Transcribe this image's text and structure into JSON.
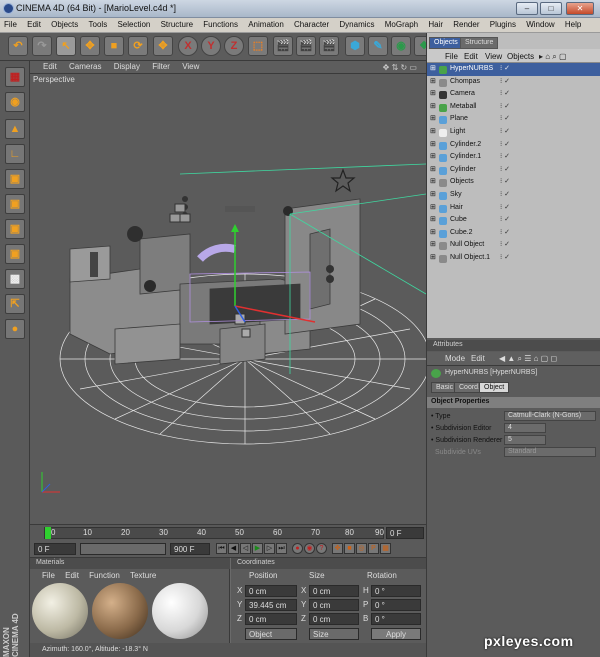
{
  "window": {
    "title": "CINEMA 4D (64 Bit) - [MarioLevel.c4d *]",
    "buttons": [
      "–",
      "□",
      "✕"
    ]
  },
  "menu": [
    "File",
    "Edit",
    "Objects",
    "Tools",
    "Selection",
    "Structure",
    "Functions",
    "Animation",
    "Character",
    "Dynamics",
    "MoGraph",
    "Hair",
    "Render",
    "Plugins",
    "Window",
    "Help"
  ],
  "toolbar": {
    "axis_labels": [
      "X",
      "Y",
      "Z"
    ]
  },
  "viewport": {
    "menu": [
      "Edit",
      "Cameras",
      "Display",
      "Filter",
      "View"
    ],
    "label": "Perspective"
  },
  "timeline": {
    "ticks": [
      "0",
      "10",
      "20",
      "30",
      "40",
      "50",
      "60",
      "70",
      "80",
      "90"
    ],
    "frame_field": "0 F"
  },
  "transport": {
    "start": "0 F",
    "end": "900 F"
  },
  "materials": {
    "header": "Materials",
    "menu": [
      "File",
      "Edit",
      "Function",
      "Texture"
    ]
  },
  "coordinates": {
    "header": "Coordinates",
    "cols": [
      "Position",
      "Size",
      "Rotation"
    ],
    "rows": [
      {
        "axis": "X",
        "pos": "0 cm",
        "size_axis": "X",
        "size": "0 cm",
        "rot_axis": "H",
        "rot": "0 °"
      },
      {
        "axis": "Y",
        "pos": "39.445 cm",
        "size_axis": "Y",
        "size": "0 cm",
        "rot_axis": "P",
        "rot": "0 °"
      },
      {
        "axis": "Z",
        "pos": "0 cm",
        "size_axis": "Z",
        "size": "0 cm",
        "rot_axis": "B",
        "rot": "0 °"
      }
    ],
    "mode1": "Object",
    "mode2": "Size",
    "apply": "Apply"
  },
  "status": "Azimuth: 160.0°, Altitude: -18.3°  N",
  "object_manager": {
    "tabs": [
      "Objects",
      "Structure"
    ],
    "menu": [
      "File",
      "Edit",
      "View",
      "Objects"
    ],
    "objects": [
      {
        "name": "HyperNURBS",
        "selected": true,
        "icon_color": "#49a34a"
      },
      {
        "name": "Chompas",
        "selected": false,
        "icon_color": "#8a8a8a"
      },
      {
        "name": "Camera",
        "selected": false,
        "icon_color": "#333333"
      },
      {
        "name": "Metaball",
        "selected": false,
        "icon_color": "#49a34a"
      },
      {
        "name": "Plane",
        "selected": false,
        "icon_color": "#5aa0d8"
      },
      {
        "name": "Light",
        "selected": false,
        "icon_color": "#eeeeee"
      },
      {
        "name": "Cylinder.2",
        "selected": false,
        "icon_color": "#5aa0d8"
      },
      {
        "name": "Cylinder.1",
        "selected": false,
        "icon_color": "#5aa0d8"
      },
      {
        "name": "Cylinder",
        "selected": false,
        "icon_color": "#5aa0d8"
      },
      {
        "name": "Objects",
        "selected": false,
        "icon_color": "#8a8a8a"
      },
      {
        "name": "Sky",
        "selected": false,
        "icon_color": "#5aa0d8"
      },
      {
        "name": "Hair",
        "selected": false,
        "icon_color": "#5aa0d8"
      },
      {
        "name": "Cube",
        "selected": false,
        "icon_color": "#5aa0d8"
      },
      {
        "name": "Cube.2",
        "selected": false,
        "icon_color": "#5aa0d8"
      },
      {
        "name": "Null Object",
        "selected": false,
        "icon_color": "#8a8a8a"
      },
      {
        "name": "Null Object.1",
        "selected": false,
        "icon_color": "#8a8a8a"
      }
    ]
  },
  "attributes": {
    "header": "Attributes",
    "menu": [
      "Mode",
      "Edit"
    ],
    "object_title": "HyperNURBS [HyperNURBS]",
    "tabs": [
      "Basic",
      "Coord.",
      "Object"
    ],
    "section": "Object Properties",
    "props": [
      {
        "label": "Type",
        "value": "Catmull-Clark (N-Gons)"
      },
      {
        "label": "Subdivision Editor",
        "value": "4"
      },
      {
        "label": "Subdivision Renderer",
        "value": "5"
      },
      {
        "label": "Subdivide UVs",
        "value": "Standard"
      }
    ]
  },
  "branding": {
    "maxon": "MAXON CINEMA 4D",
    "watermark": "pxleyes.com"
  }
}
